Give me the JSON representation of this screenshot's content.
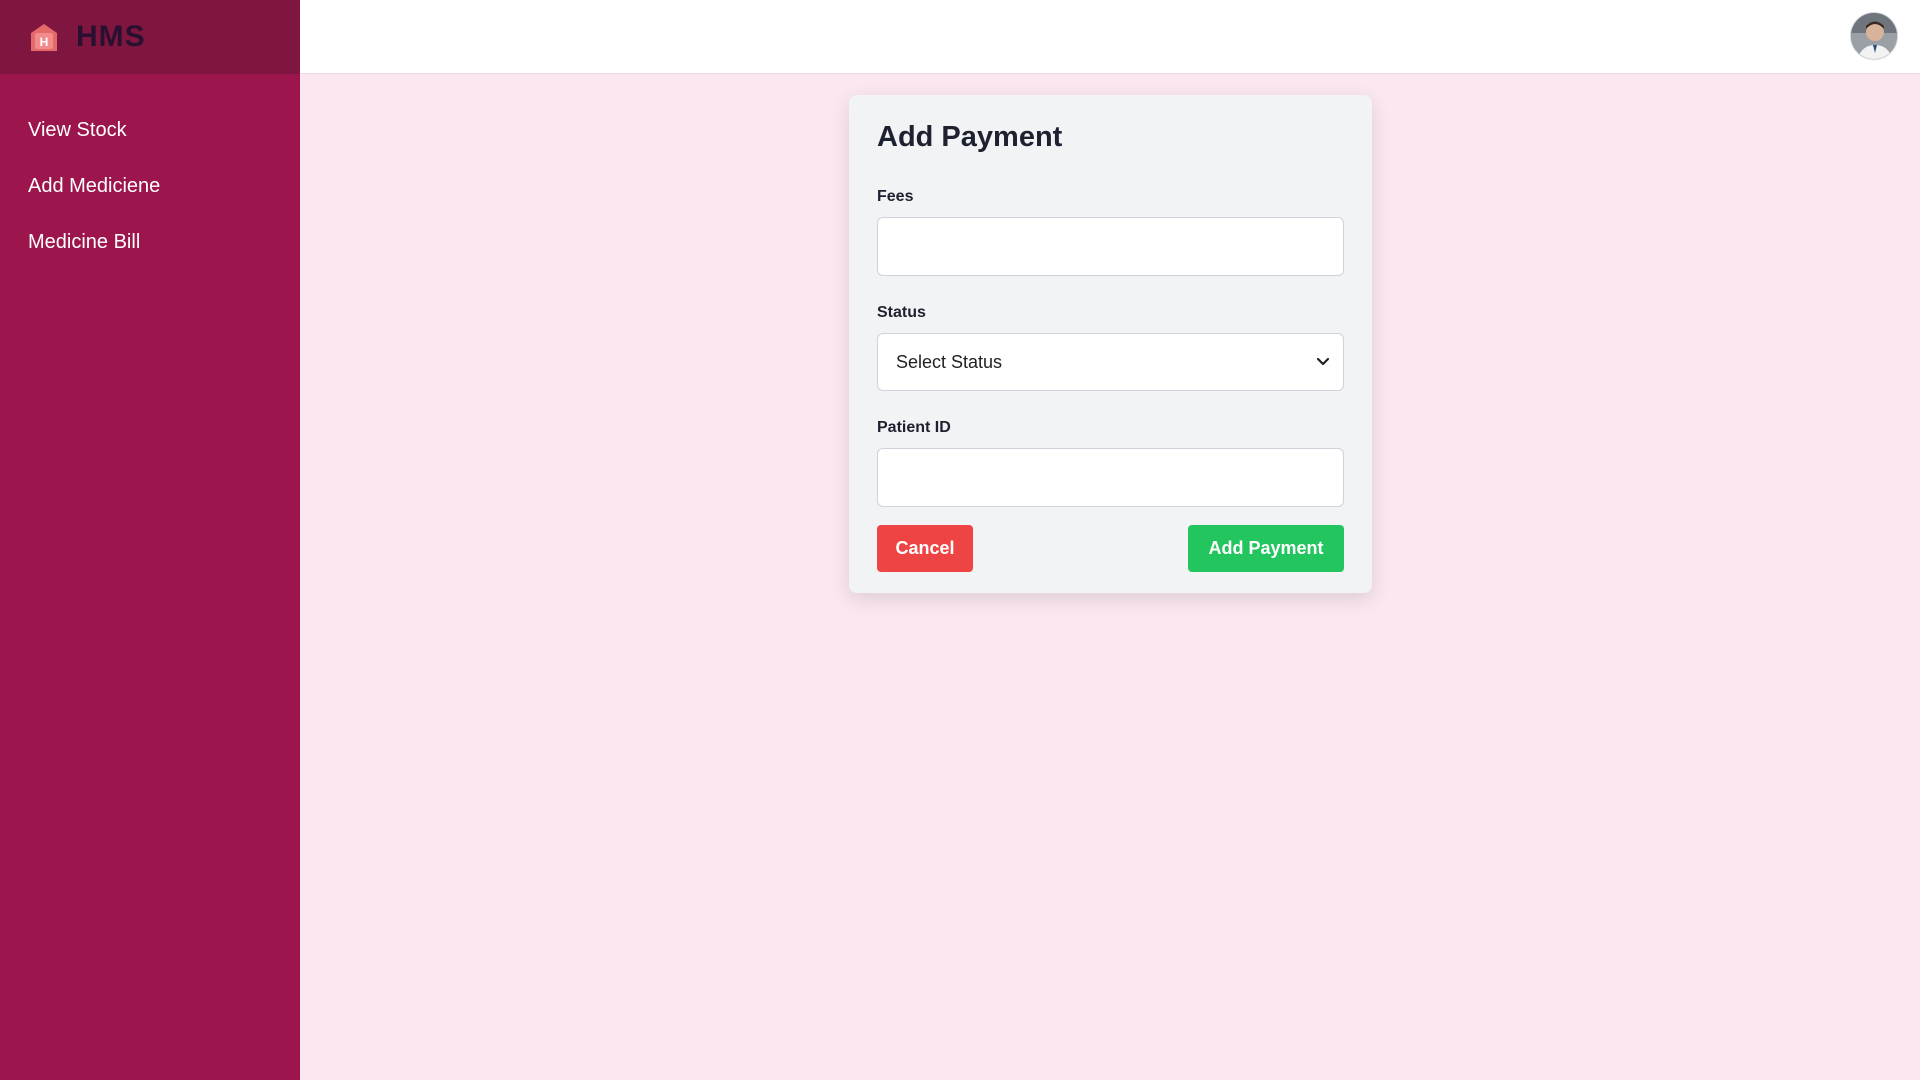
{
  "app": {
    "brand_name": "HMS"
  },
  "sidebar": {
    "items": [
      {
        "label": "View Stock"
      },
      {
        "label": "Add Mediciene"
      },
      {
        "label": "Medicine Bill"
      }
    ]
  },
  "form": {
    "title": "Add Payment",
    "fees": {
      "label": "Fees",
      "value": ""
    },
    "status": {
      "label": "Status",
      "selected": "Select Status"
    },
    "patient_id": {
      "label": "Patient ID",
      "value": ""
    },
    "cancel_label": "Cancel",
    "submit_label": "Add Payment"
  },
  "colors": {
    "sidebar": "#9c164d",
    "brand_bar": "#7e1640",
    "page_bg": "#fbe7f1",
    "cancel": "#ef4444",
    "submit": "#22c55e"
  },
  "icons": {
    "logo": "hospital-icon",
    "avatar": "user-avatar",
    "select_arrow": "chevron-down-icon"
  }
}
